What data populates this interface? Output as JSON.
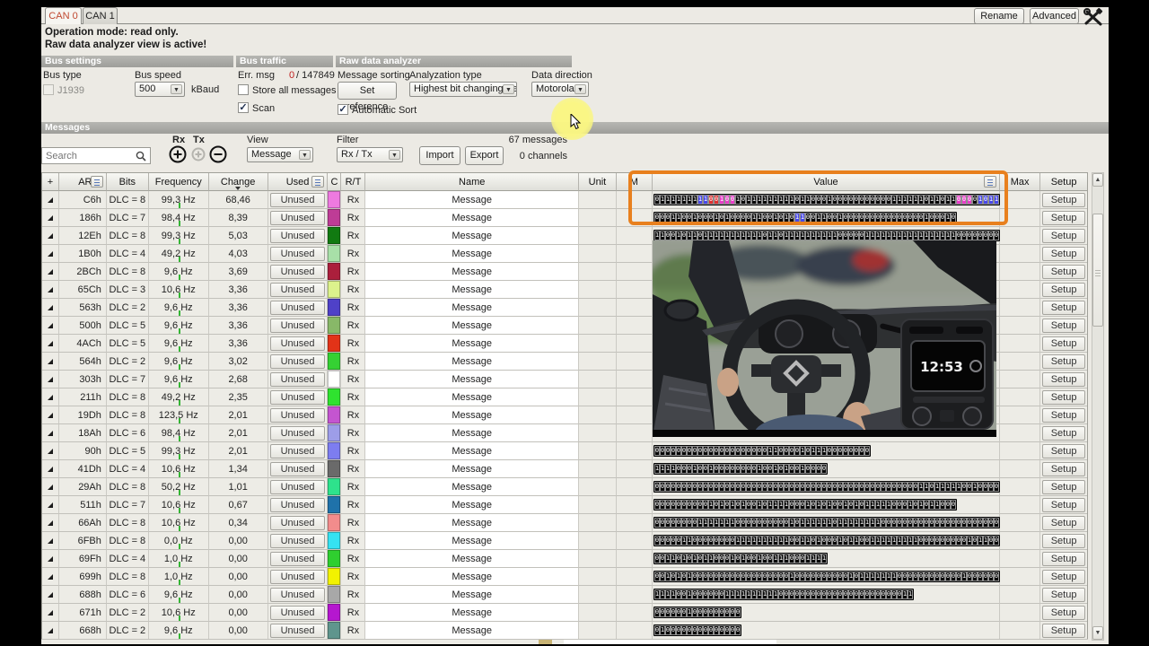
{
  "tabs": [
    {
      "label": "CAN 0"
    },
    {
      "label": "CAN 1"
    }
  ],
  "topbar": {
    "rename": "Rename",
    "advanced": "Advanced"
  },
  "info": {
    "line1": "Operation mode: read only.",
    "line2": "Raw data analyzer view is active!"
  },
  "bus_settings": {
    "title": "Bus settings",
    "bus_type_label": "Bus type",
    "j1939_label": "J1939",
    "bus_speed_label": "Bus speed",
    "bus_speed_value": "500",
    "bus_speed_unit": "kBaud"
  },
  "bus_traffic": {
    "title": "Bus traffic",
    "err_label": "Err. msg",
    "err_count": "0",
    "err_total": "/ 147849",
    "store_label": "Store all messages",
    "scan_label": "Scan",
    "scan_check": "✓"
  },
  "raw_analyzer": {
    "title": "Raw data analyzer",
    "sorting_label": "Message sorting",
    "set_reference": "Set reference",
    "auto_sort_label": "Automatic Sort",
    "auto_sort_check": "✓",
    "analyzation_label": "Analyzation type",
    "analyzation_value": "Highest bit changing freq",
    "direction_label": "Data direction",
    "direction_value": "Motorola"
  },
  "messages_bar": {
    "title": "Messages"
  },
  "toolbar": {
    "search_placeholder": "Search",
    "rx_label": "Rx",
    "tx_label": "Tx",
    "view_label": "View",
    "view_value": "Message",
    "filter_label": "Filter",
    "filter_value": "Rx / Tx",
    "import": "Import",
    "export": "Export",
    "count_messages": "67 messages",
    "count_channels": "0 channels"
  },
  "overlay": {
    "clock": "12:53"
  },
  "table": {
    "headers": {
      "expand": "+",
      "arb": "ARB.",
      "bits": "Bits",
      "frequency": "Frequency",
      "change": "Change",
      "used": "Used",
      "color": "C",
      "rt": "R/T",
      "name": "Name",
      "unit": "Unit",
      "min": "M",
      "value": "Value",
      "max": "Max",
      "setup": "Setup"
    },
    "unused_label": "Unused",
    "setup_label": "Setup",
    "rows": [
      {
        "arb": "C6h",
        "bits_label": "DLC = 8",
        "freq": "99,3 Hz",
        "change": "68,46",
        "rt": "Rx",
        "name": "Message",
        "color": "#EE7AE0",
        "value_bits": "0111111111001001011111111101100010000000000011111101101100001011",
        "hl": [
          {
            "s": 8,
            "l": 2,
            "c": "#4848E8"
          },
          {
            "s": 10,
            "l": 2,
            "c": "#E03030"
          },
          {
            "s": 12,
            "l": 3,
            "c": "#E83CC8"
          },
          {
            "s": 56,
            "l": 3,
            "c": "#E83CC8"
          },
          {
            "s": 60,
            "l": 4,
            "c": "#4848E8"
          }
        ]
      },
      {
        "arb": "186h",
        "bits_label": "DLC = 7",
        "freq": "98,4 Hz",
        "change": "8,39",
        "rt": "Rx",
        "name": "Message",
        "color": "#BE3C96",
        "value_bits": "00011001000101000011001010110011001000000000000000100010",
        "hl": [
          {
            "s": 26,
            "l": 2,
            "c": "#4848E8"
          }
        ]
      },
      {
        "arb": "12Eh",
        "bits_label": "DLC = 8",
        "freq": "99,3 Hz",
        "change": "5,03",
        "rt": "Rx",
        "name": "Message",
        "color": "#117A11",
        "value_bits": "1100101101111111111101101111111111000001111111111111111100000000",
        "hl": []
      },
      {
        "arb": "1B0h",
        "bits_label": "DLC = 4",
        "freq": "49,2 Hz",
        "change": "4,03",
        "rt": "Rx",
        "name": "Message",
        "color": "#A8E0A8",
        "value_bits": null,
        "hl": []
      },
      {
        "arb": "2BCh",
        "bits_label": "DLC = 8",
        "freq": "9,6 Hz",
        "change": "3,69",
        "rt": "Rx",
        "name": "Message",
        "color": "#AB1F3C",
        "value_bits": null,
        "hl": []
      },
      {
        "arb": "65Ch",
        "bits_label": "DLC = 3",
        "freq": "10,6 Hz",
        "change": "3,36",
        "rt": "Rx",
        "name": "Message",
        "color": "#DCF28C",
        "value_bits": null,
        "hl": []
      },
      {
        "arb": "563h",
        "bits_label": "DLC = 2",
        "freq": "9,6 Hz",
        "change": "3,36",
        "rt": "Rx",
        "name": "Message",
        "color": "#4F41C8",
        "value_bits": null,
        "hl": []
      },
      {
        "arb": "500h",
        "bits_label": "DLC = 5",
        "freq": "9,6 Hz",
        "change": "3,36",
        "rt": "Rx",
        "name": "Message",
        "color": "#88B868",
        "value_bits": null,
        "hl": []
      },
      {
        "arb": "4ACh",
        "bits_label": "DLC = 5",
        "freq": "9,6 Hz",
        "change": "3,36",
        "rt": "Rx",
        "name": "Message",
        "color": "#E23318",
        "value_bits": null,
        "hl": []
      },
      {
        "arb": "564h",
        "bits_label": "DLC = 2",
        "freq": "9,6 Hz",
        "change": "3,02",
        "rt": "Rx",
        "name": "Message",
        "color": "#35D133",
        "value_bits": null,
        "hl": []
      },
      {
        "arb": "303h",
        "bits_label": "DLC = 7",
        "freq": "9,6 Hz",
        "change": "2,68",
        "rt": "Rx",
        "name": "Message",
        "color": "#FFFFFF",
        "value_bits": null,
        "hl": []
      },
      {
        "arb": "211h",
        "bits_label": "DLC = 8",
        "freq": "49,2 Hz",
        "change": "2,35",
        "rt": "Rx",
        "name": "Message",
        "color": "#2FE22F",
        "value_bits": null,
        "hl": []
      },
      {
        "arb": "19Dh",
        "bits_label": "DLC = 8",
        "freq": "123,5 Hz",
        "change": "2,01",
        "rt": "Rx",
        "name": "Message",
        "color": "#C455D0",
        "value_bits": null,
        "hl": []
      },
      {
        "arb": "18Ah",
        "bits_label": "DLC = 6",
        "freq": "98,4 Hz",
        "change": "2,01",
        "rt": "Rx",
        "name": "Message",
        "color": "#9D9DE8",
        "value_bits": null,
        "hl": []
      },
      {
        "arb": "90h",
        "bits_label": "DLC = 5",
        "freq": "99,3 Hz",
        "change": "2,01",
        "rt": "Rx",
        "name": "Message",
        "color": "#7D7DF0",
        "value_bits": "0000000000000000000001100001011100000000",
        "hl": []
      },
      {
        "arb": "41Dh",
        "bits_label": "DLC = 4",
        "freq": "10,6 Hz",
        "change": "1,34",
        "rt": "Rx",
        "name": "Message",
        "color": "#6A6A6A",
        "value_bits": "11110001001000000001001010010000",
        "hl": []
      },
      {
        "arb": "29Ah",
        "bits_label": "DLC = 8",
        "freq": "50,2 Hz",
        "change": "1,01",
        "rt": "Rx",
        "name": "Message",
        "color": "#2EE28C",
        "value_bits": "0000000000000000000000000000000000000000000000000110111110010000",
        "hl": []
      },
      {
        "arb": "511h",
        "bits_label": "DLC = 7",
        "freq": "10,6 Hz",
        "change": "0,67",
        "rt": "Rx",
        "name": "Message",
        "color": "#1F72AA",
        "value_bits": "00000000001010101001011110001010100101011111000101011000",
        "hl": []
      },
      {
        "arb": "66Ah",
        "bits_label": "DLC = 8",
        "freq": "10,6 Hz",
        "change": "0,34",
        "rt": "Rx",
        "name": "Message",
        "color": "#F28C8C",
        "value_bits": "0000000011111110000000000101111110111111110000000000000000000000",
        "hl": []
      },
      {
        "arb": "6FBh",
        "bits_label": "DLC = 8",
        "freq": "0,0 Hz",
        "change": "0,00",
        "rt": "Rx",
        "name": "Message",
        "color": "#35E2F2",
        "value_bits": "0000011000000001111111111001101000101100111111111000000000101100",
        "hl": []
      },
      {
        "arb": "69Fh",
        "bits_label": "DLC = 4",
        "freq": "1,0 Hz",
        "change": "0,00",
        "rt": "Rx",
        "name": "Message",
        "color": "#2FCF2F",
        "value_bits": "00110101011000101001001110001111",
        "hl": []
      },
      {
        "arb": "699h",
        "bits_label": "DLC = 8",
        "freq": "1,0 Hz",
        "change": "0,00",
        "rt": "Rx",
        "name": "Message",
        "color": "#F2F200",
        "value_bits": "0010101000000000000000000100000000001011111110000000000001000000",
        "hl": []
      },
      {
        "arb": "688h",
        "bits_label": "DLC = 6",
        "freq": "9,6 Hz",
        "change": "0,00",
        "rt": "Rx",
        "name": "Message",
        "color": "#A8A8A8",
        "value_bits": "111100100000011111111110000000000000000000000011",
        "hl": []
      },
      {
        "arb": "671h",
        "bits_label": "DLC = 2",
        "freq": "10,6 Hz",
        "change": "0,00",
        "rt": "Rx",
        "name": "Message",
        "color": "#B517CF",
        "value_bits": "0000001000000000",
        "hl": []
      },
      {
        "arb": "668h",
        "bits_label": "DLC = 2",
        "freq": "9,6 Hz",
        "change": "0,00",
        "rt": "Rx",
        "name": "Message",
        "color": "#5F958D",
        "value_bits": "0100000000000000",
        "hl": []
      }
    ]
  }
}
